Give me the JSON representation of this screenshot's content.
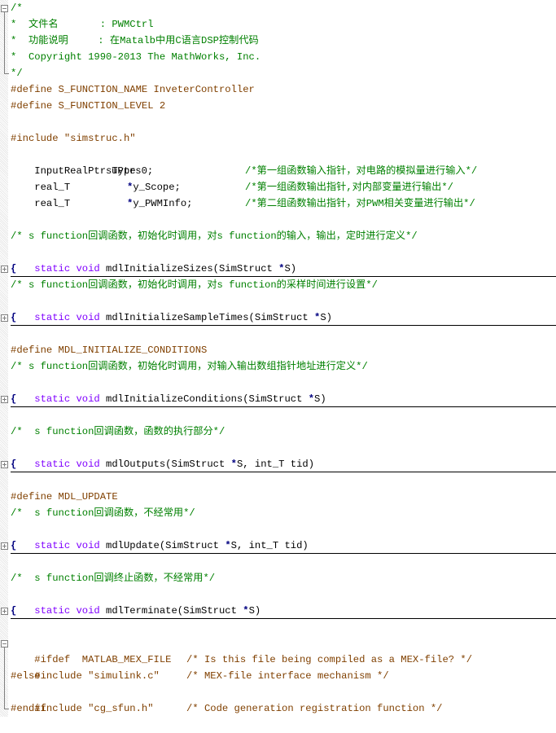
{
  "editor": {
    "header_comment": {
      "open": "/*",
      "line1": "*  文件名       : PWMCtrl",
      "line2": "*  功能说明     : 在Matalb中用C语言DSP控制代码",
      "line3": "*  Copyright 1990-2013 The MathWorks, Inc.",
      "close": "*/"
    },
    "defines": {
      "name": "#define S_FUNCTION_NAME InveterController",
      "level": "#define S_FUNCTION_LEVEL 2"
    },
    "include_simstruc": "#include \"simstruc.h\"",
    "declarations": [
      {
        "type": "InputRealPtrsType",
        "name": "uPtrs0;",
        "comment": "/*第一组函数输入指针，对电路的模拟量进行输入*/"
      },
      {
        "type": "real_T",
        "name": "*y_Scope;",
        "comment": "/*第一组函数输出指针,对内部变量进行输出*/"
      },
      {
        "type": "real_T",
        "name": "*y_PWMInfo;",
        "comment": "/*第二组函数输出指针，对PWM相关变量进行输出*/"
      }
    ],
    "functions": [
      {
        "define": "",
        "comment": "/* s function回调函数，初始化时调用，对s function的输入，输出，定时进行定义*/",
        "keywords": "static void",
        "signature": " mdlInitializeSizes(SimStruct ",
        "ptr": "*",
        "tail": "S)",
        "brace": "{"
      },
      {
        "define": "",
        "comment": "/* s function回调函数，初始化时调用，对s function的采样时间进行设置*/",
        "keywords": "static void",
        "signature": " mdlInitializeSampleTimes(SimStruct ",
        "ptr": "*",
        "tail": "S)",
        "brace": "{"
      },
      {
        "define": "#define MDL_INITIALIZE_CONDITIONS",
        "comment": "/* s function回调函数，初始化时调用，对输入输出数组指针地址进行定义*/",
        "keywords": "static void",
        "signature": " mdlInitializeConditions(SimStruct ",
        "ptr": "*",
        "tail": "S)",
        "brace": "{"
      },
      {
        "define": "",
        "comment": "/*  s function回调函数，函数的执行部分*/",
        "keywords": "static void",
        "signature": " mdlOutputs(SimStruct ",
        "ptr": "*",
        "tail": "S, int_T tid)",
        "brace": "{"
      },
      {
        "define": "#define MDL_UPDATE",
        "comment": "/*  s function回调函数，不经常用*/",
        "keywords": "static void",
        "signature": " mdlUpdate(SimStruct ",
        "ptr": "*",
        "tail": "S, int_T tid)",
        "brace": "{"
      },
      {
        "define": "",
        "comment": "/*  s function回调终止函数，不经常用*/",
        "keywords": "static void",
        "signature": " mdlTerminate(SimStruct ",
        "ptr": "*",
        "tail": "S)",
        "brace": "{"
      }
    ],
    "footer": {
      "ifdef": "#ifdef  MATLAB_MEX_FILE",
      "ifdef_comment": "/* Is this file being compiled as a MEX-file? */",
      "include_simulink": "#include \"simulink.c\"",
      "include_simulink_comment": "/* MEX-file interface mechanism */",
      "else": "#else",
      "include_cg": "#include \"cg_sfun.h\"",
      "include_cg_comment": "/* Code generation registration function */",
      "endif": "#endif"
    }
  }
}
